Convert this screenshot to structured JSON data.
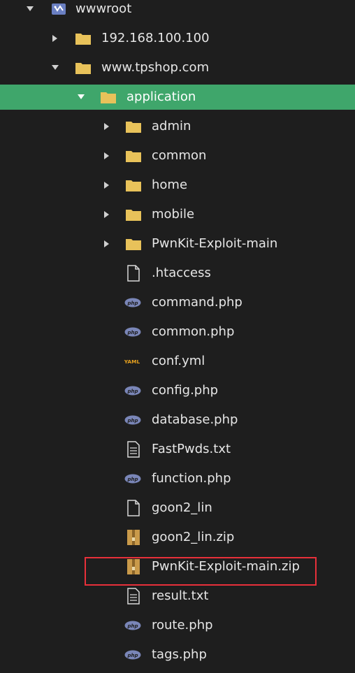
{
  "tree": {
    "root": {
      "label": "wwwroot",
      "expanded": true,
      "icon": "drive-folder-icon"
    },
    "items": [
      {
        "label": "192.168.100.100",
        "type": "folder",
        "expanded": false
      },
      {
        "label": "www.tpshop.com",
        "type": "folder",
        "expanded": true
      },
      {
        "label": "application",
        "type": "folder",
        "expanded": true,
        "selected": true
      },
      {
        "label": "admin",
        "type": "folder",
        "expanded": false
      },
      {
        "label": "common",
        "type": "folder",
        "expanded": false
      },
      {
        "label": "home",
        "type": "folder",
        "expanded": false
      },
      {
        "label": "mobile",
        "type": "folder",
        "expanded": false
      },
      {
        "label": "PwnKit-Exploit-main",
        "type": "folder",
        "expanded": false
      },
      {
        "label": ".htaccess",
        "type": "file"
      },
      {
        "label": "command.php",
        "type": "php"
      },
      {
        "label": "common.php",
        "type": "php"
      },
      {
        "label": "conf.yml",
        "type": "yaml"
      },
      {
        "label": "config.php",
        "type": "php"
      },
      {
        "label": "database.php",
        "type": "php"
      },
      {
        "label": "FastPwds.txt",
        "type": "text"
      },
      {
        "label": "function.php",
        "type": "php"
      },
      {
        "label": "goon2_lin",
        "type": "file"
      },
      {
        "label": "goon2_lin.zip",
        "type": "zip"
      },
      {
        "label": "PwnKit-Exploit-main.zip",
        "type": "zip",
        "highlighted": true
      },
      {
        "label": "result.txt",
        "type": "text"
      },
      {
        "label": "route.php",
        "type": "php"
      },
      {
        "label": "tags.php",
        "type": "php"
      }
    ]
  },
  "colors": {
    "background": "#1e1e1e",
    "selected": "#3fa66b",
    "folder": "#e8c25a",
    "highlight_border": "#e8303a",
    "php_badge": "#7a86b8"
  },
  "icons": {
    "php": "php-icon",
    "yaml": "yaml-icon",
    "text": "text-file-icon",
    "file": "blank-file-icon",
    "zip": "zip-archive-icon",
    "folder": "folder-icon"
  }
}
